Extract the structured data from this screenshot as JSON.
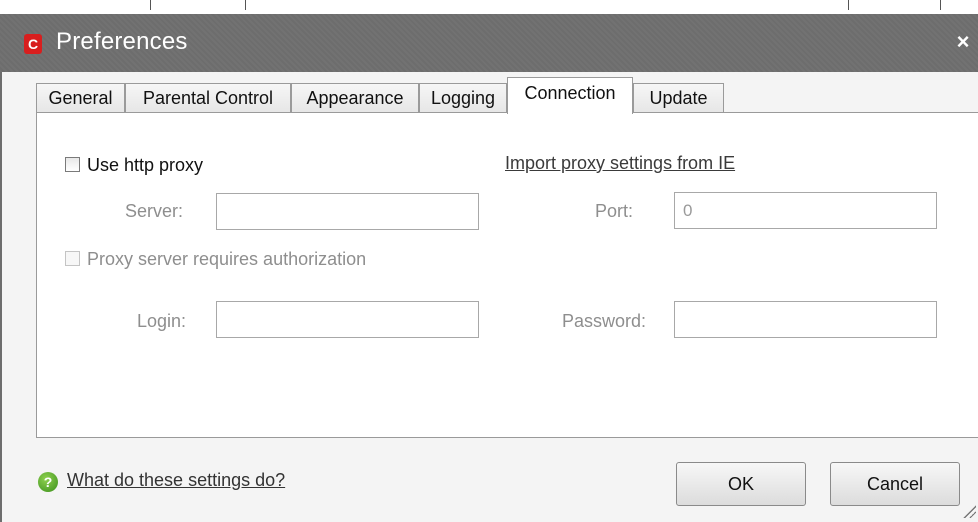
{
  "window": {
    "title": "Preferences",
    "app_icon_letter": "C",
    "close_glyph": "×"
  },
  "tabs": [
    {
      "label": "General",
      "active": false
    },
    {
      "label": "Parental Control",
      "active": false
    },
    {
      "label": "Appearance",
      "active": false
    },
    {
      "label": "Logging",
      "active": false
    },
    {
      "label": "Connection",
      "active": true
    },
    {
      "label": "Update",
      "active": false
    }
  ],
  "connection": {
    "use_proxy_label": "Use http proxy",
    "use_proxy_checked": false,
    "import_link": "Import proxy settings from IE",
    "server_label": "Server:",
    "server_value": "",
    "port_label": "Port:",
    "port_value": "0",
    "auth_label": "Proxy server requires authorization",
    "auth_checked": false,
    "login_label": "Login:",
    "login_value": "",
    "password_label": "Password:",
    "password_value": ""
  },
  "footer": {
    "help_link": "What do these settings do?",
    "help_icon": "question-icon",
    "ok_label": "OK",
    "cancel_label": "Cancel"
  },
  "colors": {
    "titlebar": "#6d6d6d",
    "app_icon": "#d81e1e",
    "help_icon": "#4a9e24"
  }
}
